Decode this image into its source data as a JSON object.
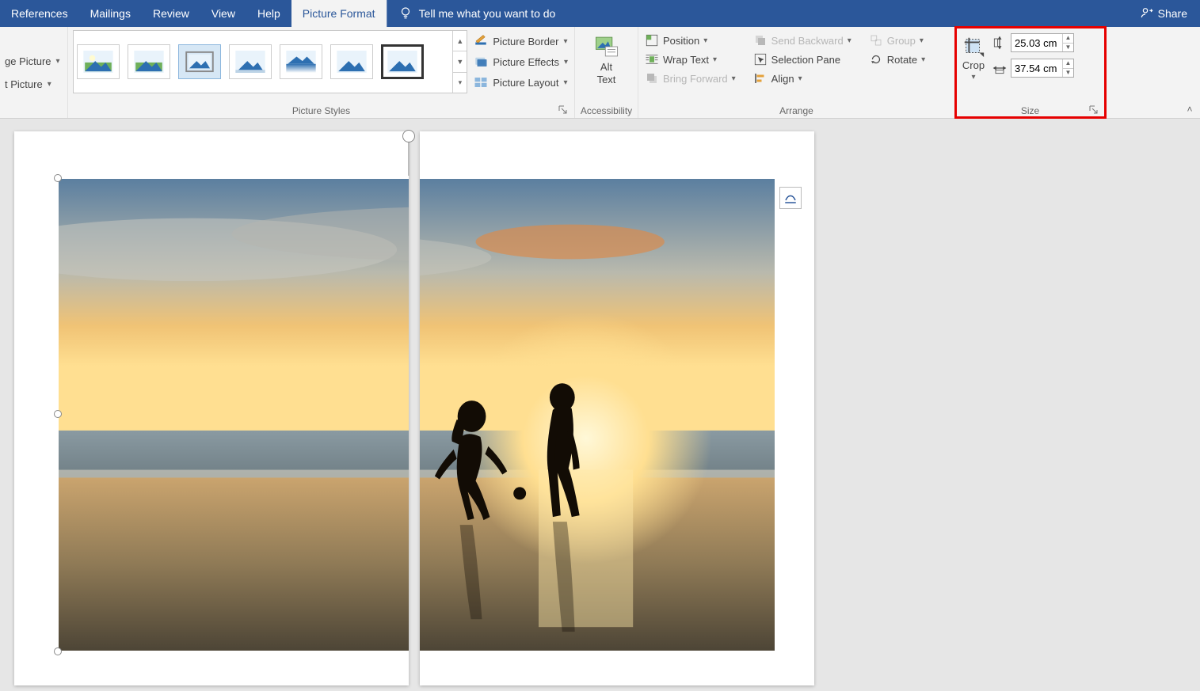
{
  "tabs": {
    "references": "References",
    "mailings": "Mailings",
    "review": "Review",
    "view": "View",
    "help": "Help",
    "picture_format": "Picture Format"
  },
  "tell_me": "Tell me what you want to do",
  "share": "Share",
  "adjust": {
    "change_picture": "ge Picture",
    "reset_picture": "t Picture"
  },
  "groups": {
    "picture_styles": "Picture Styles",
    "accessibility": "Accessibility",
    "arrange": "Arrange",
    "size": "Size"
  },
  "picopts": {
    "border": "Picture Border",
    "effects": "Picture Effects",
    "layout": "Picture Layout"
  },
  "alt_text": {
    "line1": "Alt",
    "line2": "Text"
  },
  "arrange": {
    "position": "Position",
    "wrap": "Wrap Text",
    "forward": "Bring Forward",
    "backward": "Send Backward",
    "selection_pane": "Selection Pane",
    "align": "Align",
    "group": "Group",
    "rotate": "Rotate"
  },
  "size": {
    "crop": "Crop",
    "height": "25.03 cm",
    "width": "37.54 cm"
  }
}
